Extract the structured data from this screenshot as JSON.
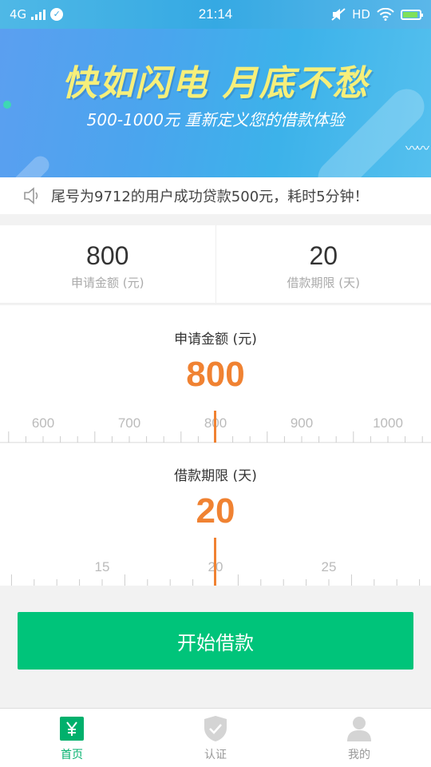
{
  "status_bar": {
    "network": "4G",
    "time": "21:14",
    "hd": "HD"
  },
  "banner": {
    "title": "快如闪电  月底不愁",
    "subtitle": "500-1000元 重新定义您的借款体验"
  },
  "notice": {
    "text": "尾号为9712的用户成功贷款500元，耗时5分钟！"
  },
  "summary": {
    "amount_value": "800",
    "amount_label": "申请金额 (元)",
    "term_value": "20",
    "term_label": "借款期限 (天)"
  },
  "amount_slider": {
    "caption": "申请金额 (元)",
    "value": "800",
    "tick_labels": [
      "600",
      "700",
      "800",
      "900",
      "1000"
    ]
  },
  "term_slider": {
    "caption": "借款期限 (天)",
    "value": "20",
    "tick_labels": [
      "15",
      "20",
      "25"
    ]
  },
  "cta": {
    "label": "开始借款"
  },
  "tabbar": {
    "items": [
      {
        "label": "首页",
        "icon": "yen-icon"
      },
      {
        "label": "认证",
        "icon": "shield-check-icon"
      },
      {
        "label": "我的",
        "icon": "user-icon"
      }
    ]
  },
  "colors": {
    "accent_green": "#00c47a",
    "accent_orange": "#f08232",
    "banner_blue": "#4aa5ee"
  }
}
